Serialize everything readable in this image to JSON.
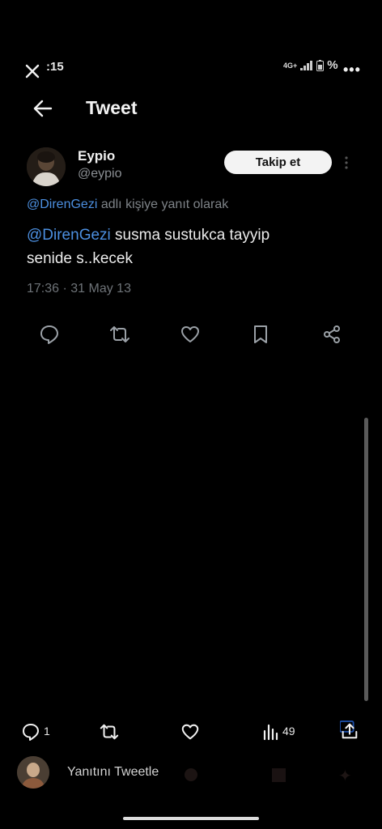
{
  "status_bar": {
    "time": ":15",
    "network": "4G+",
    "battery_percent": "%"
  },
  "header": {
    "title": "Tweet"
  },
  "tweet": {
    "author_name": "Eypio",
    "author_handle": "@eypio",
    "follow_label": "Takip et",
    "reply_context_mention": "@DirenGezi",
    "reply_context_text": " adlı kişiye yanıt olarak",
    "mention": "@DirenGezi",
    "text_line1": " susma sustukca tayyip",
    "text_line2": "senide s..kecek",
    "timestamp": "17:36 · 31 May 13"
  },
  "bottom_bar": {
    "reply_count": "1",
    "views_count": "49",
    "reply_placeholder": "Yanıtını Tweetle"
  },
  "colors": {
    "background": "#000000",
    "mention": "#4c8fe0",
    "secondary_text": "#7e8388"
  },
  "icons": [
    "close-icon",
    "back-arrow-icon",
    "more-icon",
    "reply-icon",
    "retweet-icon",
    "like-icon",
    "bookmark-icon",
    "share-icon",
    "views-icon",
    "upload-icon"
  ]
}
